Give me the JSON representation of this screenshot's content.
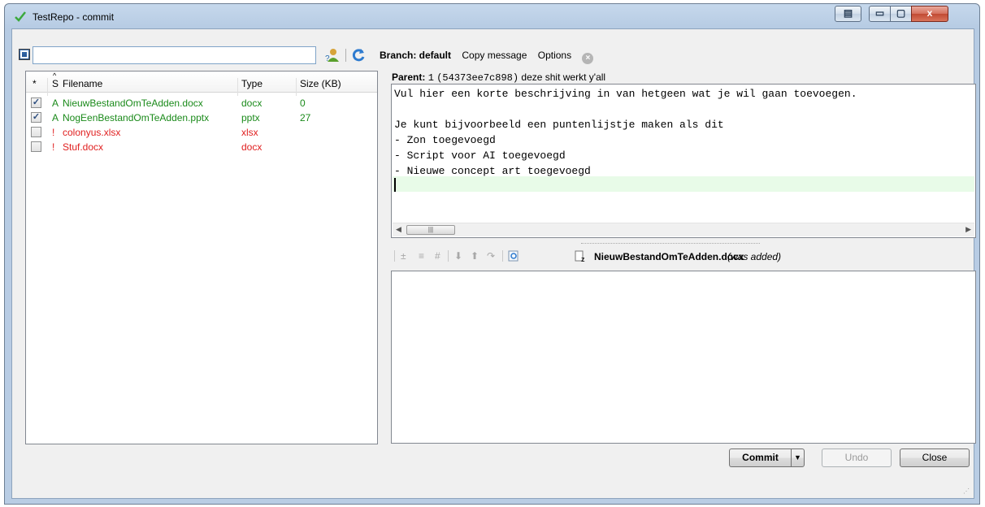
{
  "window": {
    "title": "TestRepo - commit",
    "min_symbol": "▭",
    "max_symbol": "▢",
    "close_symbol": "x"
  },
  "toolbar": {
    "filter_value": ""
  },
  "branch": {
    "label": "Branch: default",
    "copy_message": "Copy message",
    "options": "Options"
  },
  "filelist": {
    "columns": [
      "*",
      "S",
      "Filename",
      "Type",
      "Size (KB)"
    ],
    "rows": [
      {
        "checked": true,
        "status": "A",
        "name": "NieuwBestandOmTeAdden.docx",
        "type": "docx",
        "size": "0",
        "kind": "added"
      },
      {
        "checked": true,
        "status": "A",
        "name": "NogEenBestandOmTeAdden.pptx",
        "type": "pptx",
        "size": "27",
        "kind": "added"
      },
      {
        "checked": false,
        "status": "!",
        "name": "colonyus.xlsx",
        "type": "xlsx",
        "size": "",
        "kind": "missing"
      },
      {
        "checked": false,
        "status": "!",
        "name": "Stuf.docx",
        "type": "docx",
        "size": "",
        "kind": "missing"
      }
    ]
  },
  "parent": {
    "label": "Parent:",
    "rev": "1",
    "hash": "(54373ee7c898)",
    "desc": "deze shit werkt y'all"
  },
  "message": {
    "lines": [
      "Vul hier een korte beschrijving in van hetgeen wat je wil gaan toevoegen.",
      "",
      "Je kunt bijvoorbeeld een puntenlijstje maken als dit",
      "- Zon toegevoegd",
      "- Script voor AI toegevoegd",
      "- Nieuwe concept art toegevoegd"
    ]
  },
  "diff": {
    "file": "NieuwBestandOmTeAdden.docx",
    "note": "(was added)"
  },
  "buttons": {
    "commit": "Commit",
    "undo": "Undo",
    "close": "Close"
  }
}
